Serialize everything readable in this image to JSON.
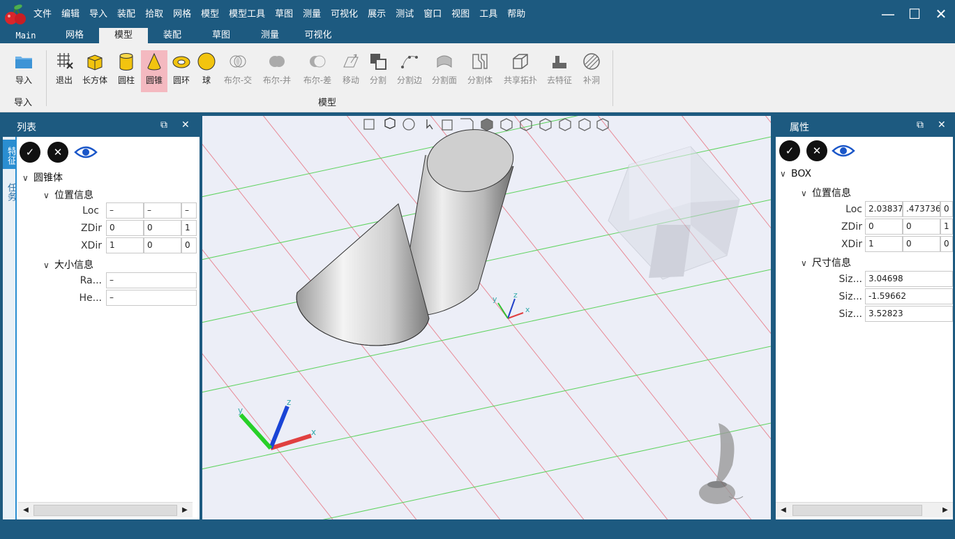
{
  "menu": [
    "文件",
    "编辑",
    "导入",
    "装配",
    "拾取",
    "网格",
    "模型",
    "模型工具",
    "草图",
    "测量",
    "可视化",
    "展示",
    "测试",
    "窗口",
    "视图",
    "工具",
    "帮助"
  ],
  "window_controls": {
    "minimize": "—",
    "maximize": "☐",
    "close": "✕"
  },
  "tabs": [
    "Main",
    "网格",
    "模型",
    "装配",
    "草图",
    "测量",
    "可视化"
  ],
  "active_tab": "模型",
  "ribbon": {
    "import_group": {
      "button": "导入",
      "label": "导入"
    },
    "model_group_label": "模型",
    "buttons": [
      "退出",
      "长方体",
      "圆柱",
      "圆锥",
      "圆环",
      "球",
      "布尔-交",
      "布尔-并",
      "布尔-差",
      "移动",
      "分割",
      "分割边",
      "分割面",
      "分割体",
      "共享拓扑",
      "去特征",
      "补洞"
    ],
    "selected": "圆锥"
  },
  "left_panel": {
    "title": "列表",
    "vertical_tabs": [
      "特征",
      "任务"
    ],
    "tree": {
      "root": "圆锥体",
      "position_group": "位置信息",
      "loc_label": "Loc",
      "loc": [
        "–",
        "–",
        "–"
      ],
      "zdir_label": "ZDir",
      "zdir": [
        "0",
        "0",
        "1"
      ],
      "xdir_label": "XDir",
      "xdir": [
        "1",
        "0",
        "0"
      ],
      "size_group": "大小信息",
      "radius_label": "Ra...",
      "radius": "–",
      "height_label": "He...",
      "height": "–"
    }
  },
  "right_panel": {
    "title": "属性",
    "tree": {
      "root": "BOX",
      "position_group": "位置信息",
      "loc_label": "Loc",
      "loc": [
        "2.03837",
        ".473736",
        "0"
      ],
      "zdir_label": "ZDir",
      "zdir": [
        "0",
        "0",
        "1"
      ],
      "xdir_label": "XDir",
      "xdir": [
        "1",
        "0",
        "0"
      ],
      "size_group": "尺寸信息",
      "size_labels": [
        "Siz...",
        "Siz...",
        "Siz..."
      ],
      "sizes": [
        "3.04698",
        "-1.59662",
        "3.52823"
      ]
    }
  },
  "axis_labels": {
    "x": "x",
    "y": "y",
    "z": "z"
  },
  "colors": {
    "chrome": "#1d5a80",
    "ribbon": "#f0f0f0",
    "selected_button": "#f4b9c0",
    "viewport_bg": "#eceef7",
    "grid_red": "#e88a96",
    "grid_green": "#5fd35f",
    "accent_blue": "#2a8ed1"
  }
}
